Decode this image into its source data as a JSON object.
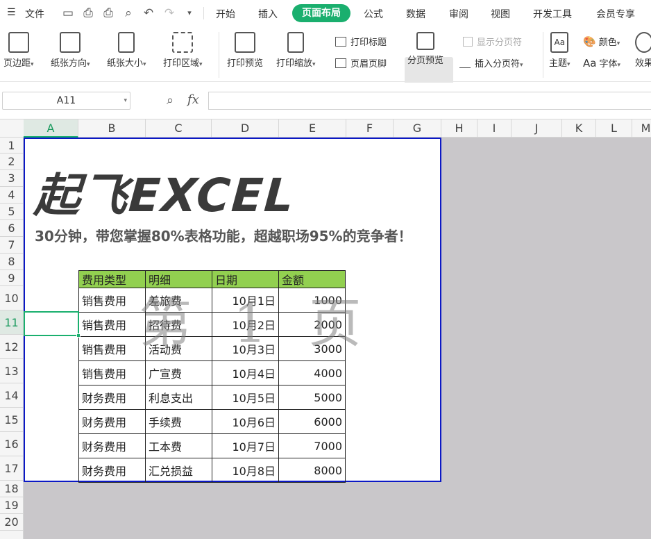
{
  "menubar": {
    "file_label": "文件",
    "tabs": [
      "开始",
      "插入",
      "页面布局",
      "公式",
      "数据",
      "审阅",
      "视图",
      "开发工具",
      "会员专享"
    ],
    "active_tab": "页面布局"
  },
  "ribbon": {
    "margins": "页边距",
    "orientation": "纸张方向",
    "size": "纸张大小",
    "print_area": "打印区域",
    "print_preview": "打印预览",
    "print_scale": "打印缩放",
    "print_titles": "打印标题",
    "header_footer": "页眉页脚",
    "page_break_preview": "分页预览",
    "show_page_breaks": "显示分页符",
    "insert_page_break": "插入分页符",
    "theme": "主题",
    "colors": "颜色",
    "fonts": "字体",
    "effects": "效果",
    "aa_icon": "Aa"
  },
  "formula_bar": {
    "name_box": "A11",
    "fx_label": "fx",
    "formula": ""
  },
  "columns": [
    "A",
    "B",
    "C",
    "D",
    "E",
    "F",
    "G",
    "H",
    "I",
    "J",
    "K",
    "L",
    "M"
  ],
  "active_column": "A",
  "rows": [
    "1",
    "2",
    "3",
    "4",
    "5",
    "6",
    "7",
    "8",
    "9",
    "10",
    "11",
    "12",
    "13",
    "14",
    "15",
    "16",
    "17",
    "18",
    "19",
    "20"
  ],
  "active_row": "11",
  "sheet": {
    "title": "起飞EXCEL",
    "subtitle": "30分钟，带您掌握80%表格功能，超越职场95%的竞争者！",
    "watermark": "第 1 页",
    "table_headers": [
      "费用类型",
      "明细",
      "日期",
      "金额"
    ],
    "table_rows": [
      [
        "销售费用",
        "差旅费",
        "10月1日",
        "1000"
      ],
      [
        "销售费用",
        "招待费",
        "10月2日",
        "2000"
      ],
      [
        "销售费用",
        "活动费",
        "10月3日",
        "3000"
      ],
      [
        "销售费用",
        "广宣费",
        "10月4日",
        "4000"
      ],
      [
        "财务费用",
        "利息支出",
        "10月5日",
        "5000"
      ],
      [
        "财务费用",
        "手续费",
        "10月6日",
        "6000"
      ],
      [
        "财务费用",
        "工本费",
        "10月7日",
        "7000"
      ],
      [
        "财务费用",
        "汇兑损益",
        "10月8日",
        "8000"
      ]
    ]
  },
  "colors": {
    "accent": "#1aaf6e",
    "header_fill": "#92d050",
    "print_border": "#0b18c5",
    "outside_area": "#c9c7ca"
  }
}
